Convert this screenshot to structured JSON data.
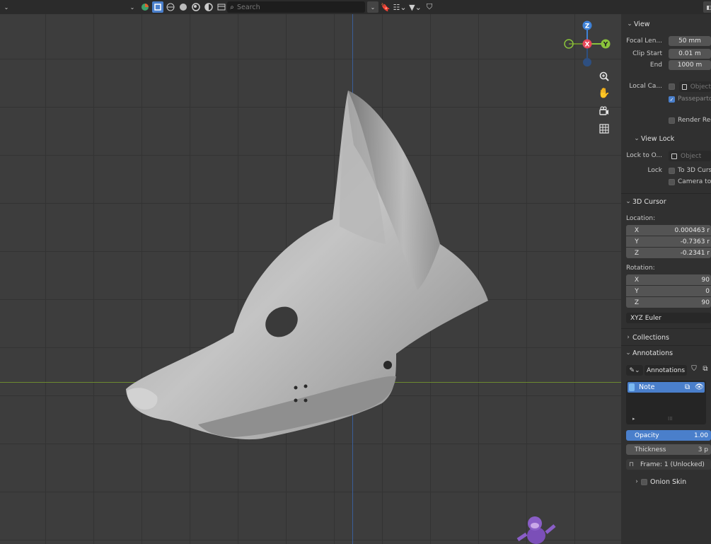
{
  "header": {
    "search_placeholder": "Search"
  },
  "gizmo": {
    "z": "Z",
    "x": "X",
    "y": "Y"
  },
  "panel": {
    "view": {
      "title": "View",
      "focal_label": "Focal Len...",
      "focal_value": "50 mm",
      "clip_start_label": "Clip Start",
      "clip_start_value": "0.01 m",
      "end_label": "End",
      "end_value": "1000 m",
      "local_camera_label": "Local Ca...",
      "object_placeholder": "Object",
      "passepartout": "Passeparto",
      "render_region": "Render Reg"
    },
    "view_lock": {
      "title": "View Lock",
      "lock_to_label": "Lock to O...",
      "object_placeholder": "Object",
      "lock_label": "Lock",
      "to_3d_cursor": "To 3D Curs",
      "camera_to": "Camera to"
    },
    "cursor": {
      "title": "3D Cursor",
      "location_label": "Location:",
      "loc_x": "0.000463 r",
      "loc_y": "-0.7363 r",
      "loc_z": "-0.2341 r",
      "rotation_label": "Rotation:",
      "rot_x": "90",
      "rot_y": "0",
      "rot_z": "90",
      "mode": "XYZ Euler"
    },
    "collections": {
      "title": "Collections"
    },
    "annotations": {
      "title": "Annotations",
      "layer_name": "Annotations",
      "note": "Note",
      "opacity_label": "Opacity",
      "opacity_value": "1.00",
      "thickness_label": "Thickness",
      "thickness_value": "3 p",
      "frame": "Frame: 1 (Unlocked)",
      "onion": "Onion Skin"
    }
  },
  "axis_labels": [
    "X",
    "Y",
    "Z"
  ],
  "colors": {
    "accent": "#4a7fcb",
    "axis_x": "#e8475a",
    "axis_y": "#8ac33b",
    "axis_z": "#3f82d8"
  }
}
